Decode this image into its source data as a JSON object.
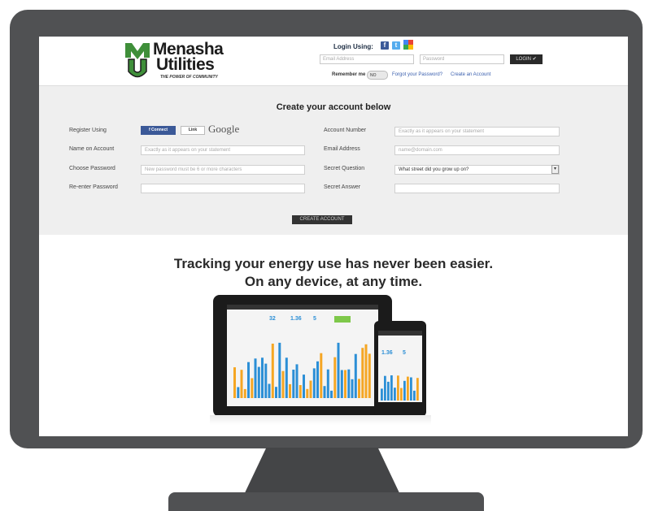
{
  "brand": {
    "name_line1": "Menasha",
    "name_line2": "Utilities",
    "tagline": "THE POWER OF COMMUNITY"
  },
  "login": {
    "label": "Login Using:",
    "social_icons": [
      "facebook-icon",
      "twitter-icon",
      "google-icon"
    ],
    "email_placeholder": "Email Address",
    "password_placeholder": "Password",
    "login_button": "LOGIN ✔",
    "remember_label": "Remember me",
    "remember_toggle": "NO",
    "forgot_link": "Forgot your Password?",
    "create_link": "Create an Account"
  },
  "create_account": {
    "title": "Create your account below",
    "register_label": "Register Using",
    "facebook_button": "f  Connect",
    "linkedin_button": "Link",
    "google_button": "Google",
    "name_label": "Name on Account",
    "name_placeholder": "Exactly as it appears on your statement",
    "password_label": "Choose Password",
    "password_placeholder": "New password must be 6 or more characters",
    "reenter_label": "Re-enter Password",
    "account_number_label": "Account Number",
    "account_number_placeholder": "Exactly as it appears on your statement",
    "email_label": "Email Address",
    "email_placeholder": "name@domain.com",
    "secret_question_label": "Secret Question",
    "secret_question_value": "What street did you grow up on?",
    "secret_answer_label": "Secret Answer",
    "submit_button": "CREATE ACCOUNT"
  },
  "promo": {
    "line1": "Tracking your energy use has never been easier.",
    "line2": "On any device, at any time."
  },
  "device_stats": {
    "tablet_values": [
      "32",
      "1.36",
      "5"
    ],
    "phone_values": [
      "1.36",
      "5"
    ]
  },
  "colors": {
    "monitor_frame": "#505153",
    "facebook_blue": "#3b5998",
    "link_blue": "#3a5fae",
    "chart_blue": "#2c8fd6",
    "chart_orange": "#f5a623",
    "brand_green": "#3f8f3a"
  }
}
